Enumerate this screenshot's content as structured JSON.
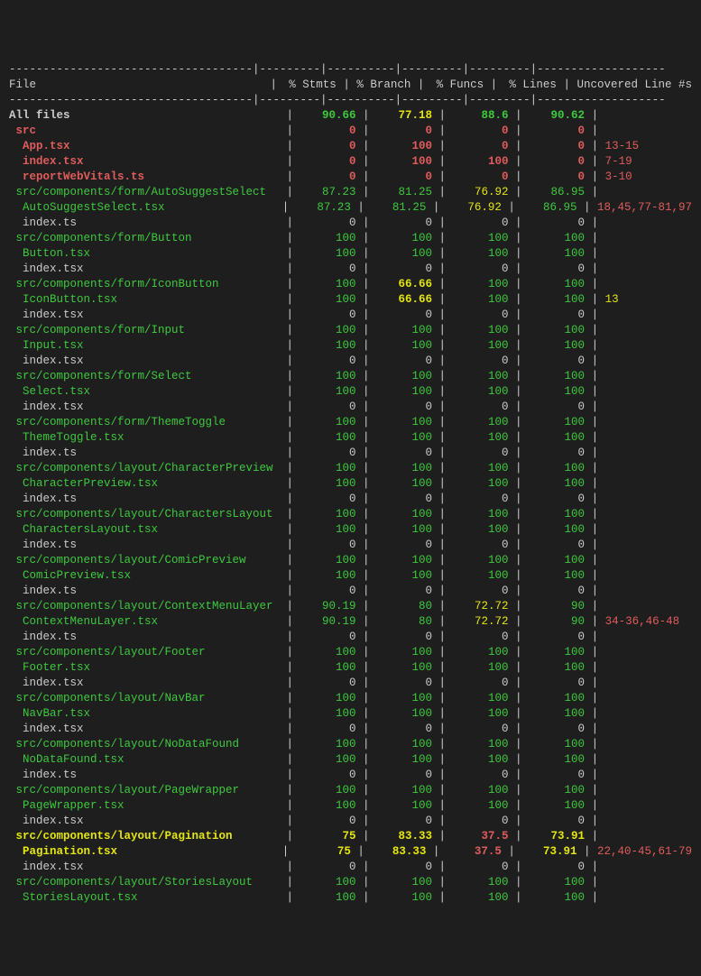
{
  "headers": {
    "file": "File",
    "stmts": "% Stmts",
    "branch": "% Branch",
    "funcs": "% Funcs",
    "lines": "% Lines",
    "uncov": "Uncovered Line #s"
  },
  "divider": "------------------------------------|---------|----------|---------|---------|-------------------",
  "rows": [
    {
      "indent": 0,
      "file": "All files",
      "fileColor": "white-b",
      "stmts": "90.66",
      "stmtsColor": "green-b",
      "branch": "77.18",
      "branchColor": "yellow-b",
      "funcs": "88.6",
      "funcsColor": "green-b",
      "lines": "90.62",
      "linesColor": "green-b",
      "uncov": "",
      "uncovColor": "white"
    },
    {
      "indent": 1,
      "file": "src",
      "fileColor": "red-b",
      "stmts": "0",
      "stmtsColor": "red-b",
      "branch": "0",
      "branchColor": "red-b",
      "funcs": "0",
      "funcsColor": "red-b",
      "lines": "0",
      "linesColor": "red-b",
      "uncov": "",
      "uncovColor": "white"
    },
    {
      "indent": 2,
      "file": "App.tsx",
      "fileColor": "red-b",
      "stmts": "0",
      "stmtsColor": "red-b",
      "branch": "100",
      "branchColor": "red-b",
      "funcs": "0",
      "funcsColor": "red-b",
      "lines": "0",
      "linesColor": "red-b",
      "uncov": "13-15",
      "uncovColor": "red"
    },
    {
      "indent": 2,
      "file": "index.tsx",
      "fileColor": "red-b",
      "stmts": "0",
      "stmtsColor": "red-b",
      "branch": "100",
      "branchColor": "red-b",
      "funcs": "100",
      "funcsColor": "red-b",
      "lines": "0",
      "linesColor": "red-b",
      "uncov": "7-19",
      "uncovColor": "red"
    },
    {
      "indent": 2,
      "file": "reportWebVitals.ts",
      "fileColor": "red-b",
      "stmts": "0",
      "stmtsColor": "red-b",
      "branch": "0",
      "branchColor": "red-b",
      "funcs": "0",
      "funcsColor": "red-b",
      "lines": "0",
      "linesColor": "red-b",
      "uncov": "3-10",
      "uncovColor": "red"
    },
    {
      "indent": 1,
      "file": "src/components/form/AutoSuggestSelect",
      "fileColor": "green",
      "stmts": "87.23",
      "stmtsColor": "green",
      "branch": "81.25",
      "branchColor": "green",
      "funcs": "76.92",
      "funcsColor": "yellow",
      "lines": "86.95",
      "linesColor": "green",
      "uncov": "",
      "uncovColor": "white"
    },
    {
      "indent": 2,
      "file": "AutoSuggestSelect.tsx",
      "fileColor": "green",
      "stmts": "87.23",
      "stmtsColor": "green",
      "branch": "81.25",
      "branchColor": "green",
      "funcs": "76.92",
      "funcsColor": "yellow",
      "lines": "86.95",
      "linesColor": "green",
      "uncov": "18,45,77-81,97",
      "uncovColor": "red"
    },
    {
      "indent": 2,
      "file": "index.ts",
      "fileColor": "white",
      "stmts": "0",
      "stmtsColor": "white",
      "branch": "0",
      "branchColor": "white",
      "funcs": "0",
      "funcsColor": "white",
      "lines": "0",
      "linesColor": "white",
      "uncov": "",
      "uncovColor": "white"
    },
    {
      "indent": 1,
      "file": "src/components/form/Button",
      "fileColor": "green",
      "stmts": "100",
      "stmtsColor": "green",
      "branch": "100",
      "branchColor": "green",
      "funcs": "100",
      "funcsColor": "green",
      "lines": "100",
      "linesColor": "green",
      "uncov": "",
      "uncovColor": "white"
    },
    {
      "indent": 2,
      "file": "Button.tsx",
      "fileColor": "green",
      "stmts": "100",
      "stmtsColor": "green",
      "branch": "100",
      "branchColor": "green",
      "funcs": "100",
      "funcsColor": "green",
      "lines": "100",
      "linesColor": "green",
      "uncov": "",
      "uncovColor": "white"
    },
    {
      "indent": 2,
      "file": "index.tsx",
      "fileColor": "white",
      "stmts": "0",
      "stmtsColor": "white",
      "branch": "0",
      "branchColor": "white",
      "funcs": "0",
      "funcsColor": "white",
      "lines": "0",
      "linesColor": "white",
      "uncov": "",
      "uncovColor": "white"
    },
    {
      "indent": 1,
      "file": "src/components/form/IconButton",
      "fileColor": "green",
      "stmts": "100",
      "stmtsColor": "green",
      "branch": "66.66",
      "branchColor": "yellow-b",
      "funcs": "100",
      "funcsColor": "green",
      "lines": "100",
      "linesColor": "green",
      "uncov": "",
      "uncovColor": "white"
    },
    {
      "indent": 2,
      "file": "IconButton.tsx",
      "fileColor": "green",
      "stmts": "100",
      "stmtsColor": "green",
      "branch": "66.66",
      "branchColor": "yellow-b",
      "funcs": "100",
      "funcsColor": "green",
      "lines": "100",
      "linesColor": "green",
      "uncov": "13",
      "uncovColor": "yellow"
    },
    {
      "indent": 2,
      "file": "index.tsx",
      "fileColor": "white",
      "stmts": "0",
      "stmtsColor": "white",
      "branch": "0",
      "branchColor": "white",
      "funcs": "0",
      "funcsColor": "white",
      "lines": "0",
      "linesColor": "white",
      "uncov": "",
      "uncovColor": "white"
    },
    {
      "indent": 1,
      "file": "src/components/form/Input",
      "fileColor": "green",
      "stmts": "100",
      "stmtsColor": "green",
      "branch": "100",
      "branchColor": "green",
      "funcs": "100",
      "funcsColor": "green",
      "lines": "100",
      "linesColor": "green",
      "uncov": "",
      "uncovColor": "white"
    },
    {
      "indent": 2,
      "file": "Input.tsx",
      "fileColor": "green",
      "stmts": "100",
      "stmtsColor": "green",
      "branch": "100",
      "branchColor": "green",
      "funcs": "100",
      "funcsColor": "green",
      "lines": "100",
      "linesColor": "green",
      "uncov": "",
      "uncovColor": "white"
    },
    {
      "indent": 2,
      "file": "index.tsx",
      "fileColor": "white",
      "stmts": "0",
      "stmtsColor": "white",
      "branch": "0",
      "branchColor": "white",
      "funcs": "0",
      "funcsColor": "white",
      "lines": "0",
      "linesColor": "white",
      "uncov": "",
      "uncovColor": "white"
    },
    {
      "indent": 1,
      "file": "src/components/form/Select",
      "fileColor": "green",
      "stmts": "100",
      "stmtsColor": "green",
      "branch": "100",
      "branchColor": "green",
      "funcs": "100",
      "funcsColor": "green",
      "lines": "100",
      "linesColor": "green",
      "uncov": "",
      "uncovColor": "white"
    },
    {
      "indent": 2,
      "file": "Select.tsx",
      "fileColor": "green",
      "stmts": "100",
      "stmtsColor": "green",
      "branch": "100",
      "branchColor": "green",
      "funcs": "100",
      "funcsColor": "green",
      "lines": "100",
      "linesColor": "green",
      "uncov": "",
      "uncovColor": "white"
    },
    {
      "indent": 2,
      "file": "index.tsx",
      "fileColor": "white",
      "stmts": "0",
      "stmtsColor": "white",
      "branch": "0",
      "branchColor": "white",
      "funcs": "0",
      "funcsColor": "white",
      "lines": "0",
      "linesColor": "white",
      "uncov": "",
      "uncovColor": "white"
    },
    {
      "indent": 1,
      "file": "src/components/form/ThemeToggle",
      "fileColor": "green",
      "stmts": "100",
      "stmtsColor": "green",
      "branch": "100",
      "branchColor": "green",
      "funcs": "100",
      "funcsColor": "green",
      "lines": "100",
      "linesColor": "green",
      "uncov": "",
      "uncovColor": "white"
    },
    {
      "indent": 2,
      "file": "ThemeToggle.tsx",
      "fileColor": "green",
      "stmts": "100",
      "stmtsColor": "green",
      "branch": "100",
      "branchColor": "green",
      "funcs": "100",
      "funcsColor": "green",
      "lines": "100",
      "linesColor": "green",
      "uncov": "",
      "uncovColor": "white"
    },
    {
      "indent": 2,
      "file": "index.ts",
      "fileColor": "white",
      "stmts": "0",
      "stmtsColor": "white",
      "branch": "0",
      "branchColor": "white",
      "funcs": "0",
      "funcsColor": "white",
      "lines": "0",
      "linesColor": "white",
      "uncov": "",
      "uncovColor": "white"
    },
    {
      "indent": 1,
      "file": "src/components/layout/CharacterPreview",
      "fileColor": "green",
      "stmts": "100",
      "stmtsColor": "green",
      "branch": "100",
      "branchColor": "green",
      "funcs": "100",
      "funcsColor": "green",
      "lines": "100",
      "linesColor": "green",
      "uncov": "",
      "uncovColor": "white"
    },
    {
      "indent": 2,
      "file": "CharacterPreview.tsx",
      "fileColor": "green",
      "stmts": "100",
      "stmtsColor": "green",
      "branch": "100",
      "branchColor": "green",
      "funcs": "100",
      "funcsColor": "green",
      "lines": "100",
      "linesColor": "green",
      "uncov": "",
      "uncovColor": "white"
    },
    {
      "indent": 2,
      "file": "index.ts",
      "fileColor": "white",
      "stmts": "0",
      "stmtsColor": "white",
      "branch": "0",
      "branchColor": "white",
      "funcs": "0",
      "funcsColor": "white",
      "lines": "0",
      "linesColor": "white",
      "uncov": "",
      "uncovColor": "white"
    },
    {
      "indent": 1,
      "file": "src/components/layout/CharactersLayout",
      "fileColor": "green",
      "stmts": "100",
      "stmtsColor": "green",
      "branch": "100",
      "branchColor": "green",
      "funcs": "100",
      "funcsColor": "green",
      "lines": "100",
      "linesColor": "green",
      "uncov": "",
      "uncovColor": "white"
    },
    {
      "indent": 2,
      "file": "CharactersLayout.tsx",
      "fileColor": "green",
      "stmts": "100",
      "stmtsColor": "green",
      "branch": "100",
      "branchColor": "green",
      "funcs": "100",
      "funcsColor": "green",
      "lines": "100",
      "linesColor": "green",
      "uncov": "",
      "uncovColor": "white"
    },
    {
      "indent": 2,
      "file": "index.ts",
      "fileColor": "white",
      "stmts": "0",
      "stmtsColor": "white",
      "branch": "0",
      "branchColor": "white",
      "funcs": "0",
      "funcsColor": "white",
      "lines": "0",
      "linesColor": "white",
      "uncov": "",
      "uncovColor": "white"
    },
    {
      "indent": 1,
      "file": "src/components/layout/ComicPreview",
      "fileColor": "green",
      "stmts": "100",
      "stmtsColor": "green",
      "branch": "100",
      "branchColor": "green",
      "funcs": "100",
      "funcsColor": "green",
      "lines": "100",
      "linesColor": "green",
      "uncov": "",
      "uncovColor": "white"
    },
    {
      "indent": 2,
      "file": "ComicPreview.tsx",
      "fileColor": "green",
      "stmts": "100",
      "stmtsColor": "green",
      "branch": "100",
      "branchColor": "green",
      "funcs": "100",
      "funcsColor": "green",
      "lines": "100",
      "linesColor": "green",
      "uncov": "",
      "uncovColor": "white"
    },
    {
      "indent": 2,
      "file": "index.ts",
      "fileColor": "white",
      "stmts": "0",
      "stmtsColor": "white",
      "branch": "0",
      "branchColor": "white",
      "funcs": "0",
      "funcsColor": "white",
      "lines": "0",
      "linesColor": "white",
      "uncov": "",
      "uncovColor": "white"
    },
    {
      "indent": 1,
      "file": "src/components/layout/ContextMenuLayer",
      "fileColor": "green",
      "stmts": "90.19",
      "stmtsColor": "green",
      "branch": "80",
      "branchColor": "green",
      "funcs": "72.72",
      "funcsColor": "yellow",
      "lines": "90",
      "linesColor": "green",
      "uncov": "",
      "uncovColor": "white"
    },
    {
      "indent": 2,
      "file": "ContextMenuLayer.tsx",
      "fileColor": "green",
      "stmts": "90.19",
      "stmtsColor": "green",
      "branch": "80",
      "branchColor": "green",
      "funcs": "72.72",
      "funcsColor": "yellow",
      "lines": "90",
      "linesColor": "green",
      "uncov": "34-36,46-48",
      "uncovColor": "red"
    },
    {
      "indent": 2,
      "file": "index.ts",
      "fileColor": "white",
      "stmts": "0",
      "stmtsColor": "white",
      "branch": "0",
      "branchColor": "white",
      "funcs": "0",
      "funcsColor": "white",
      "lines": "0",
      "linesColor": "white",
      "uncov": "",
      "uncovColor": "white"
    },
    {
      "indent": 1,
      "file": "src/components/layout/Footer",
      "fileColor": "green",
      "stmts": "100",
      "stmtsColor": "green",
      "branch": "100",
      "branchColor": "green",
      "funcs": "100",
      "funcsColor": "green",
      "lines": "100",
      "linesColor": "green",
      "uncov": "",
      "uncovColor": "white"
    },
    {
      "indent": 2,
      "file": "Footer.tsx",
      "fileColor": "green",
      "stmts": "100",
      "stmtsColor": "green",
      "branch": "100",
      "branchColor": "green",
      "funcs": "100",
      "funcsColor": "green",
      "lines": "100",
      "linesColor": "green",
      "uncov": "",
      "uncovColor": "white"
    },
    {
      "indent": 2,
      "file": "index.tsx",
      "fileColor": "white",
      "stmts": "0",
      "stmtsColor": "white",
      "branch": "0",
      "branchColor": "white",
      "funcs": "0",
      "funcsColor": "white",
      "lines": "0",
      "linesColor": "white",
      "uncov": "",
      "uncovColor": "white"
    },
    {
      "indent": 1,
      "file": "src/components/layout/NavBar",
      "fileColor": "green",
      "stmts": "100",
      "stmtsColor": "green",
      "branch": "100",
      "branchColor": "green",
      "funcs": "100",
      "funcsColor": "green",
      "lines": "100",
      "linesColor": "green",
      "uncov": "",
      "uncovColor": "white"
    },
    {
      "indent": 2,
      "file": "NavBar.tsx",
      "fileColor": "green",
      "stmts": "100",
      "stmtsColor": "green",
      "branch": "100",
      "branchColor": "green",
      "funcs": "100",
      "funcsColor": "green",
      "lines": "100",
      "linesColor": "green",
      "uncov": "",
      "uncovColor": "white"
    },
    {
      "indent": 2,
      "file": "index.tsx",
      "fileColor": "white",
      "stmts": "0",
      "stmtsColor": "white",
      "branch": "0",
      "branchColor": "white",
      "funcs": "0",
      "funcsColor": "white",
      "lines": "0",
      "linesColor": "white",
      "uncov": "",
      "uncovColor": "white"
    },
    {
      "indent": 1,
      "file": "src/components/layout/NoDataFound",
      "fileColor": "green",
      "stmts": "100",
      "stmtsColor": "green",
      "branch": "100",
      "branchColor": "green",
      "funcs": "100",
      "funcsColor": "green",
      "lines": "100",
      "linesColor": "green",
      "uncov": "",
      "uncovColor": "white"
    },
    {
      "indent": 2,
      "file": "NoDataFound.tsx",
      "fileColor": "green",
      "stmts": "100",
      "stmtsColor": "green",
      "branch": "100",
      "branchColor": "green",
      "funcs": "100",
      "funcsColor": "green",
      "lines": "100",
      "linesColor": "green",
      "uncov": "",
      "uncovColor": "white"
    },
    {
      "indent": 2,
      "file": "index.ts",
      "fileColor": "white",
      "stmts": "0",
      "stmtsColor": "white",
      "branch": "0",
      "branchColor": "white",
      "funcs": "0",
      "funcsColor": "white",
      "lines": "0",
      "linesColor": "white",
      "uncov": "",
      "uncovColor": "white"
    },
    {
      "indent": 1,
      "file": "src/components/layout/PageWrapper",
      "fileColor": "green",
      "stmts": "100",
      "stmtsColor": "green",
      "branch": "100",
      "branchColor": "green",
      "funcs": "100",
      "funcsColor": "green",
      "lines": "100",
      "linesColor": "green",
      "uncov": "",
      "uncovColor": "white"
    },
    {
      "indent": 2,
      "file": "PageWrapper.tsx",
      "fileColor": "green",
      "stmts": "100",
      "stmtsColor": "green",
      "branch": "100",
      "branchColor": "green",
      "funcs": "100",
      "funcsColor": "green",
      "lines": "100",
      "linesColor": "green",
      "uncov": "",
      "uncovColor": "white"
    },
    {
      "indent": 2,
      "file": "index.tsx",
      "fileColor": "white",
      "stmts": "0",
      "stmtsColor": "white",
      "branch": "0",
      "branchColor": "white",
      "funcs": "0",
      "funcsColor": "white",
      "lines": "0",
      "linesColor": "white",
      "uncov": "",
      "uncovColor": "white"
    },
    {
      "indent": 1,
      "file": "src/components/layout/Pagination",
      "fileColor": "yellow-b",
      "stmts": "75",
      "stmtsColor": "yellow-b",
      "branch": "83.33",
      "branchColor": "yellow-b",
      "funcs": "37.5",
      "funcsColor": "red-b",
      "lines": "73.91",
      "linesColor": "yellow-b",
      "uncov": "",
      "uncovColor": "white"
    },
    {
      "indent": 2,
      "file": "Pagination.tsx",
      "fileColor": "yellow-b",
      "stmts": "75",
      "stmtsColor": "yellow-b",
      "branch": "83.33",
      "branchColor": "yellow-b",
      "funcs": "37.5",
      "funcsColor": "red-b",
      "lines": "73.91",
      "linesColor": "yellow-b",
      "uncov": "22,40-45,61-79",
      "uncovColor": "red"
    },
    {
      "indent": 2,
      "file": "index.tsx",
      "fileColor": "white",
      "stmts": "0",
      "stmtsColor": "white",
      "branch": "0",
      "branchColor": "white",
      "funcs": "0",
      "funcsColor": "white",
      "lines": "0",
      "linesColor": "white",
      "uncov": "",
      "uncovColor": "white"
    },
    {
      "indent": 1,
      "file": "src/components/layout/StoriesLayout",
      "fileColor": "green",
      "stmts": "100",
      "stmtsColor": "green",
      "branch": "100",
      "branchColor": "green",
      "funcs": "100",
      "funcsColor": "green",
      "lines": "100",
      "linesColor": "green",
      "uncov": "",
      "uncovColor": "white"
    },
    {
      "indent": 2,
      "file": "StoriesLayout.tsx",
      "fileColor": "green",
      "stmts": "100",
      "stmtsColor": "green",
      "branch": "100",
      "branchColor": "green",
      "funcs": "100",
      "funcsColor": "green",
      "lines": "100",
      "linesColor": "green",
      "uncov": "",
      "uncovColor": "white"
    }
  ]
}
